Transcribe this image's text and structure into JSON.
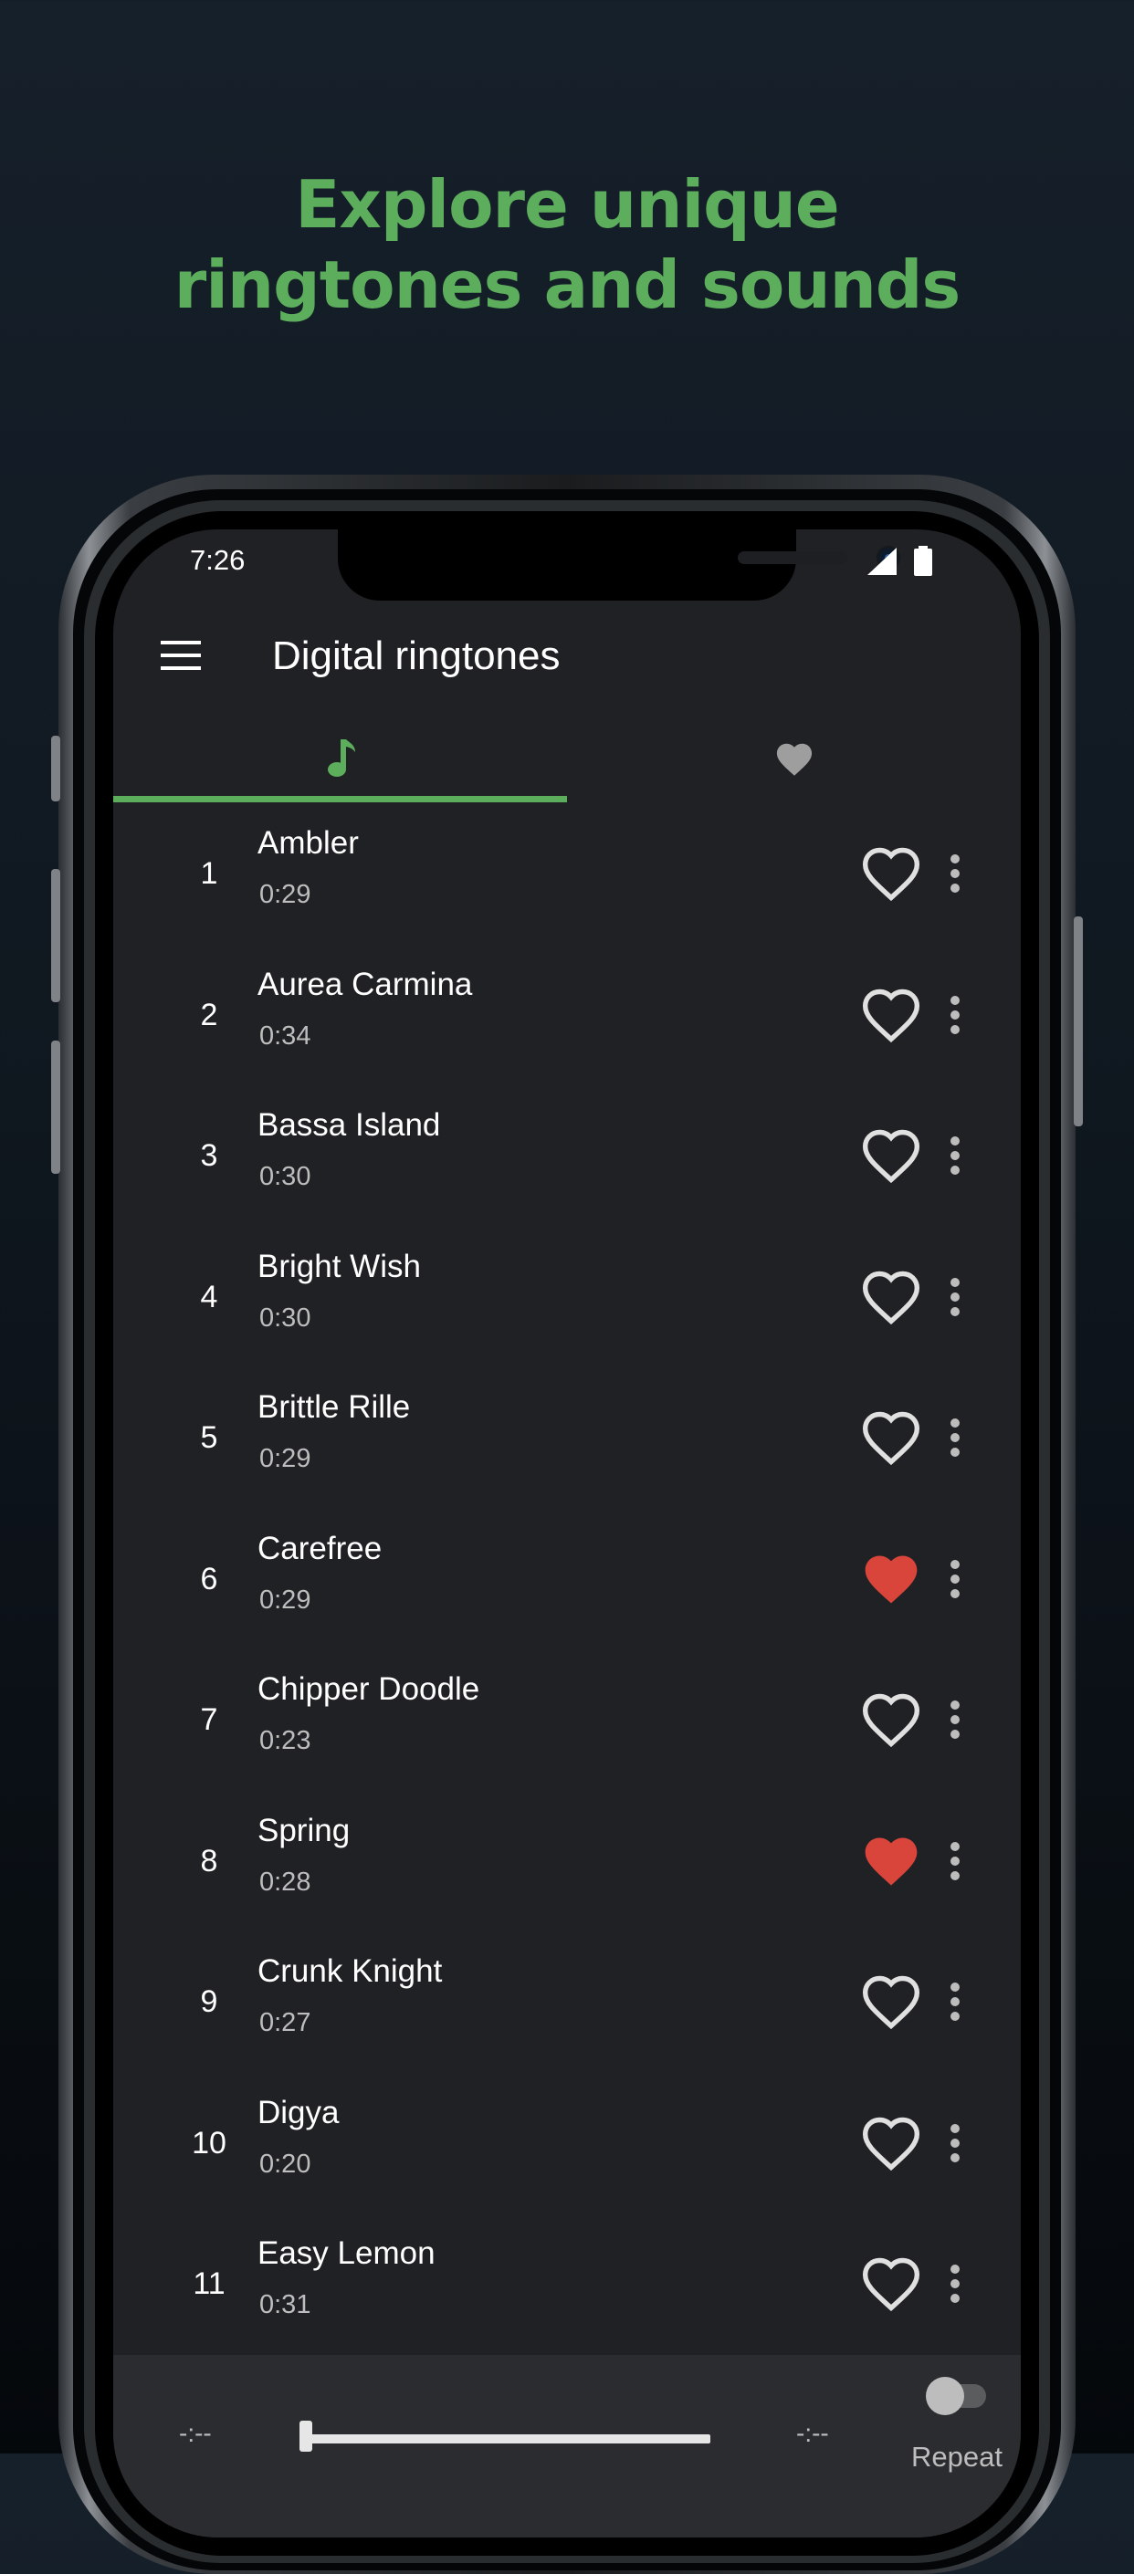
{
  "promo": {
    "headline_line1": "Explore unique",
    "headline_line2": "ringtones and sounds",
    "accent_color": "#5cad5c"
  },
  "status_bar": {
    "time": "7:26",
    "icons": [
      "signal-icon",
      "battery-icon"
    ]
  },
  "app_bar": {
    "title": "Digital ringtones",
    "menu_icon": "menu-icon"
  },
  "tabs": [
    {
      "icon": "music-note-icon",
      "selected": true
    },
    {
      "icon": "heart-icon",
      "selected": false
    }
  ],
  "ringtones": [
    {
      "number": "1",
      "title": "Ambler",
      "duration": "0:29",
      "favorite": false
    },
    {
      "number": "2",
      "title": "Aurea Carmina",
      "duration": "0:34",
      "favorite": false
    },
    {
      "number": "3",
      "title": "Bassa Island",
      "duration": "0:30",
      "favorite": false
    },
    {
      "number": "4",
      "title": "Bright Wish",
      "duration": "0:30",
      "favorite": false
    },
    {
      "number": "5",
      "title": "Brittle Rille",
      "duration": "0:29",
      "favorite": false
    },
    {
      "number": "6",
      "title": "Carefree",
      "duration": "0:29",
      "favorite": true
    },
    {
      "number": "7",
      "title": "Chipper Doodle",
      "duration": "0:23",
      "favorite": false
    },
    {
      "number": "8",
      "title": "Spring",
      "duration": "0:28",
      "favorite": true
    },
    {
      "number": "9",
      "title": "Crunk Knight",
      "duration": "0:27",
      "favorite": false
    },
    {
      "number": "10",
      "title": "Digya",
      "duration": "0:20",
      "favorite": false
    },
    {
      "number": "11",
      "title": "Easy Lemon",
      "duration": "0:31",
      "favorite": false
    }
  ],
  "player": {
    "elapsed": "-:--",
    "remaining": "-:--",
    "progress": 0,
    "repeat_label": "Repeat",
    "repeat_on": false
  },
  "colors": {
    "favorite_active": "#d9453b",
    "icon_idle": "#e0e0e0",
    "tab_idle": "#9e9e9e"
  }
}
